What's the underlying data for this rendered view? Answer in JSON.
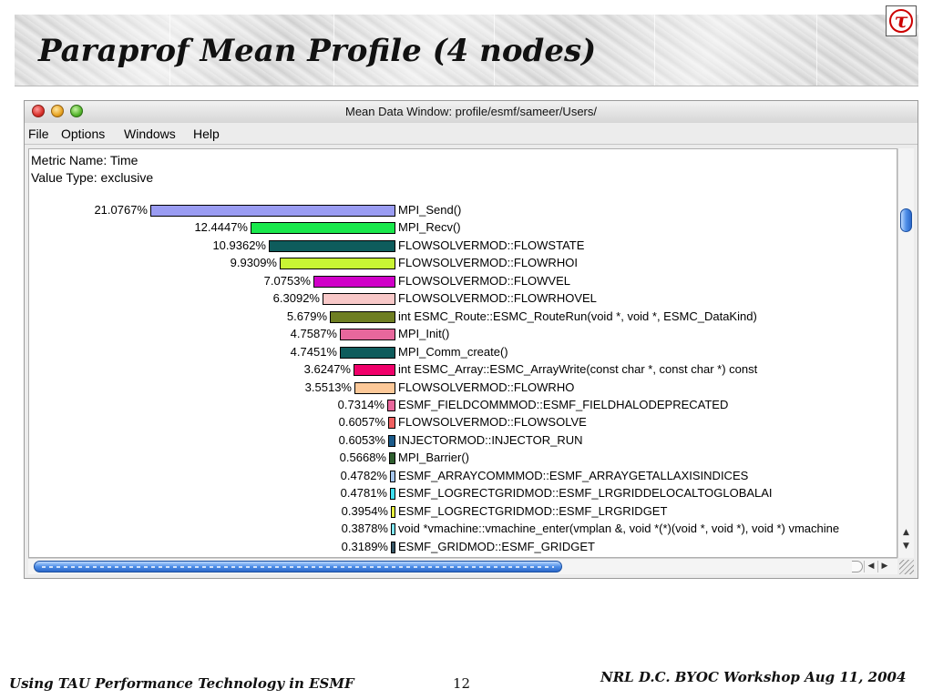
{
  "slide": {
    "title": "Paraprof Mean Profile (4 nodes)",
    "logo_glyph": "τ",
    "footer_left": "Using TAU Performance Technology in ESMF",
    "page_number": "12",
    "footer_right": "NRL D.C. BYOC Workshop Aug 11, 2004"
  },
  "window": {
    "title": "Mean Data Window: profile/esmf/sameer/Users/",
    "menu": [
      "File",
      "Options",
      "Windows",
      "Help"
    ],
    "metric_label": "Metric Name: Time",
    "value_type_label": "Value Type: exclusive",
    "rows": [
      {
        "percent": "21.0767%",
        "value": 21.0767,
        "name": "MPI_Send()",
        "color": "#9a9cf2"
      },
      {
        "percent": "12.4447%",
        "value": 12.4447,
        "name": "MPI_Recv()",
        "color": "#19e84c"
      },
      {
        "percent": "10.9362%",
        "value": 10.9362,
        "name": "FLOWSOLVERMOD::FLOWSTATE",
        "color": "#0e5c5c"
      },
      {
        "percent": "9.9309%",
        "value": 9.9309,
        "name": "FLOWSOLVERMOD::FLOWRHOI",
        "color": "#c9f534"
      },
      {
        "percent": "7.0753%",
        "value": 7.0753,
        "name": "FLOWSOLVERMOD::FLOWVEL",
        "color": "#d000c8"
      },
      {
        "percent": "6.3092%",
        "value": 6.3092,
        "name": "FLOWSOLVERMOD::FLOWRHOVEL",
        "color": "#f8c8c8"
      },
      {
        "percent": "5.679%",
        "value": 5.679,
        "name": "int ESMC_Route::ESMC_RouteRun(void *, void *, ESMC_DataKind)",
        "color": "#6e7e22"
      },
      {
        "percent": "4.7587%",
        "value": 4.7587,
        "name": "MPI_Init()",
        "color": "#e8679c"
      },
      {
        "percent": "4.7451%",
        "value": 4.7451,
        "name": "MPI_Comm_create()",
        "color": "#0e5c5c"
      },
      {
        "percent": "3.6247%",
        "value": 3.6247,
        "name": "int ESMC_Array::ESMC_ArrayWrite(const char *, const char *) const",
        "color": "#f0006a"
      },
      {
        "percent": "3.5513%",
        "value": 3.5513,
        "name": "FLOWSOLVERMOD::FLOWRHO",
        "color": "#fcc898"
      },
      {
        "percent": "0.7314%",
        "value": 0.7314,
        "name": "ESMF_FIELDCOMMMOD::ESMF_FIELDHALODEPRECATED",
        "color": "#e8679c"
      },
      {
        "percent": "0.6057%",
        "value": 0.6057,
        "name": "FLOWSOLVERMOD::FLOWSOLVE",
        "color": "#f06060"
      },
      {
        "percent": "0.6053%",
        "value": 0.6053,
        "name": "INJECTORMOD::INJECTOR_RUN",
        "color": "#1a5a8a"
      },
      {
        "percent": "0.5668%",
        "value": 0.5668,
        "name": "MPI_Barrier()",
        "color": "#2f5f2f"
      },
      {
        "percent": "0.4782%",
        "value": 0.4782,
        "name": "ESMF_ARRAYCOMMMOD::ESMF_ARRAYGETALLAXISINDICES",
        "color": "#a8c8f0"
      },
      {
        "percent": "0.4781%",
        "value": 0.4781,
        "name": "ESMF_LOGRECTGRIDMOD::ESMF_LRGRIDDELOCALTOGLOBALAI",
        "color": "#40e0f0"
      },
      {
        "percent": "0.3954%",
        "value": 0.3954,
        "name": "ESMF_LOGRECTGRIDMOD::ESMF_LRGRIDGET",
        "color": "#e8f040"
      },
      {
        "percent": "0.3878%",
        "value": 0.3878,
        "name": "void *vmachine::vmachine_enter(vmplan &, void *(*)(void *, void *), void *) vmachine",
        "color": "#80e8f8"
      },
      {
        "percent": "0.3189%",
        "value": 0.3189,
        "name": "ESMF_GRIDMOD::ESMF_GRIDGET",
        "color": "#3a5a6a"
      }
    ]
  }
}
